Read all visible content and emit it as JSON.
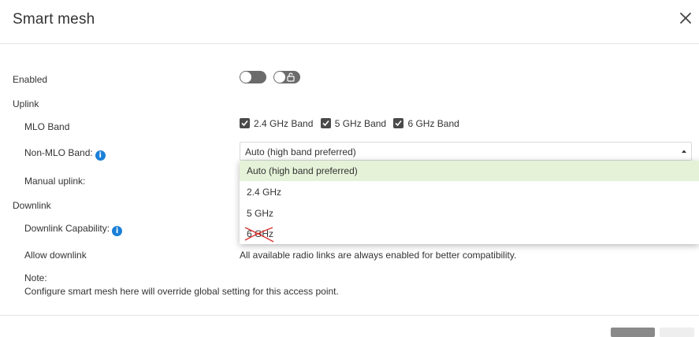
{
  "dialog": {
    "title": "Smart mesh",
    "close_icon": "close-icon"
  },
  "form": {
    "enabled_label": "Enabled",
    "enabled_toggle": "off",
    "uplink_section": "Uplink",
    "mlo_band_label": "MLO Band",
    "mlo_bands": [
      {
        "label": "2.4 GHz Band",
        "checked": true
      },
      {
        "label": "5 GHz Band",
        "checked": true
      },
      {
        "label": "6 GHz Band",
        "checked": true
      }
    ],
    "non_mlo_label": "Non-MLO Band:",
    "non_mlo_value": "Auto (high band preferred)",
    "non_mlo_options": [
      "Auto (high band preferred)",
      "2.4 GHz",
      "5 GHz",
      "6 GHz"
    ],
    "manual_uplink_label": "Manual uplink:",
    "downlink_section": "Downlink",
    "downlink_capability_label": "Downlink Capability:",
    "allow_downlink_label": "Allow downlink",
    "allow_downlink_text": "All available radio links are always enabled for better compatibility.",
    "note_label": "Note:",
    "note_text": "Configure smart mesh here will override global setting for this access point."
  },
  "colors": {
    "accent": "#1a7fd8",
    "selected_option_bg": "#e5f2d8",
    "toggle": "#6b6b6b",
    "strike": "#d9302c"
  }
}
